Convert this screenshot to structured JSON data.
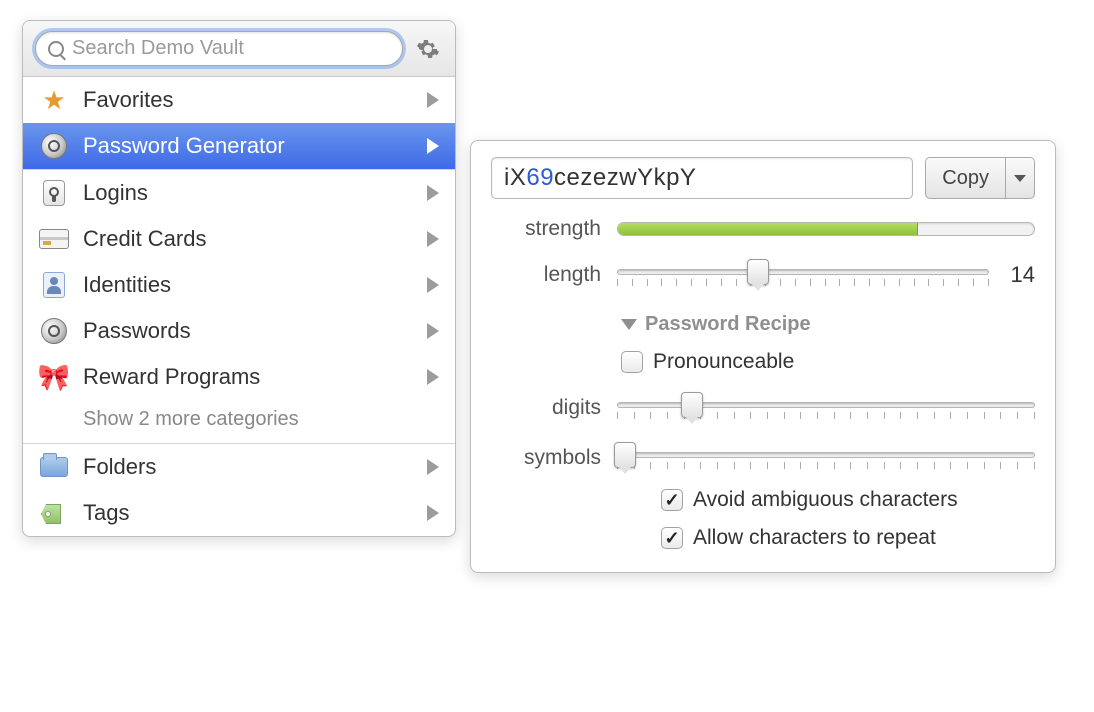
{
  "search": {
    "placeholder": "Search Demo Vault"
  },
  "sidebar": {
    "top": [
      {
        "icon": "star-icon",
        "label": "Favorites"
      },
      {
        "icon": "safe-dial-icon",
        "label": "Password Generator",
        "selected": true
      }
    ],
    "categories": [
      {
        "icon": "keyhole-icon",
        "label": "Logins"
      },
      {
        "icon": "credit-card-icon",
        "label": "Credit Cards"
      },
      {
        "icon": "identity-icon",
        "label": "Identities"
      },
      {
        "icon": "safe-dial-icon",
        "label": "Passwords"
      },
      {
        "icon": "bow-icon",
        "label": "Reward Programs"
      }
    ],
    "show_more": "Show 2 more categories",
    "bottom": [
      {
        "icon": "folder-icon",
        "label": "Folders"
      },
      {
        "icon": "tag-icon",
        "label": "Tags"
      }
    ]
  },
  "generator": {
    "password_parts": [
      {
        "t": "iX",
        "kind": "alpha"
      },
      {
        "t": "69",
        "kind": "digit"
      },
      {
        "t": "cezezwYkpY",
        "kind": "alpha"
      }
    ],
    "copy_label": "Copy",
    "strength_label": "strength",
    "strength_pct": 72,
    "length_label": "length",
    "length_value": "14",
    "length_slider_pct": 38,
    "recipe_header": "Password Recipe",
    "pronounceable_label": "Pronounceable",
    "pronounceable_checked": false,
    "digits_label": "digits",
    "digits_slider_pct": 18,
    "symbols_label": "symbols",
    "symbols_slider_pct": 2,
    "avoid_label": "Avoid ambiguous characters",
    "avoid_checked": true,
    "repeat_label": "Allow characters to repeat",
    "repeat_checked": true
  }
}
